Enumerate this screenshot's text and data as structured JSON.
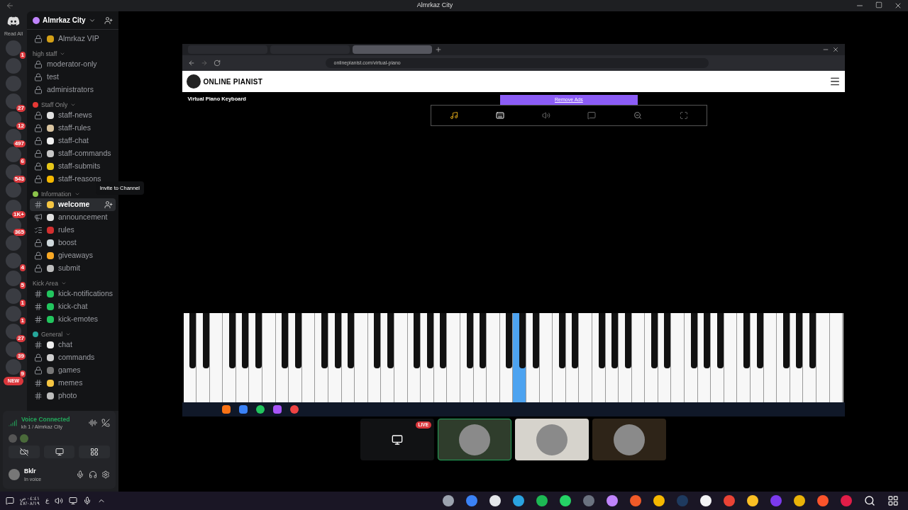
{
  "window": {
    "title": "Almrkaz City"
  },
  "servers": {
    "read_all": "Read All",
    "new_label": "NEW",
    "items": [
      {
        "kind": "badge",
        "badge": "1"
      },
      {
        "kind": "plain"
      },
      {
        "kind": "plain"
      },
      {
        "kind": "badge",
        "badge": "27"
      },
      {
        "kind": "badge",
        "badge": "12"
      },
      {
        "kind": "badge",
        "badge": "497"
      },
      {
        "kind": "badge",
        "badge": "6"
      },
      {
        "kind": "badge",
        "badge": "543"
      },
      {
        "kind": "plain"
      },
      {
        "kind": "badge",
        "badge": "1K+"
      },
      {
        "kind": "badge",
        "badge": "365"
      },
      {
        "kind": "plain"
      },
      {
        "kind": "badge",
        "badge": "4"
      },
      {
        "kind": "badge",
        "badge": "5"
      },
      {
        "kind": "badge",
        "badge": "1"
      },
      {
        "kind": "badge",
        "badge": "1"
      },
      {
        "kind": "badge",
        "badge": "27"
      },
      {
        "kind": "badge",
        "badge": "39"
      },
      {
        "kind": "badge",
        "badge": "9"
      }
    ]
  },
  "server_header": {
    "name": "Almrkaz City"
  },
  "pinned_channel": {
    "name": "Almrkaz VIP",
    "kind": "locked",
    "color": "#d4a017"
  },
  "categories": [
    {
      "name": "high staff",
      "channels": [
        {
          "name": "moderator-only",
          "kind": "locked",
          "selected": false
        },
        {
          "name": "test",
          "kind": "locked",
          "selected": false
        },
        {
          "name": "administrators",
          "kind": "locked",
          "selected": false
        }
      ]
    },
    {
      "name": "Staff Only",
      "color": "#e53935",
      "channels": [
        {
          "name": "staff-news",
          "kind": "locked",
          "color": "#e0e0e0",
          "selected": false
        },
        {
          "name": "staff-rules",
          "kind": "locked",
          "color": "#d9c4a0",
          "selected": false
        },
        {
          "name": "staff-chat",
          "kind": "locked",
          "color": "#f0f0f0",
          "selected": false
        },
        {
          "name": "staff-commands",
          "kind": "locked",
          "color": "#c8c8c8",
          "selected": false
        },
        {
          "name": "staff-submits",
          "kind": "locked",
          "color": "#e6c619",
          "selected": false
        },
        {
          "name": "staff-reasons",
          "kind": "locked",
          "color": "#f5b800",
          "selected": false
        }
      ]
    },
    {
      "name": "Information",
      "color": "#8bc34a",
      "channels": [
        {
          "name": "welcome",
          "kind": "text",
          "color": "#f5c542",
          "selected": true
        },
        {
          "name": "announcement",
          "kind": "announce",
          "color": "#e0e0e0",
          "selected": false
        },
        {
          "name": "rules",
          "kind": "rules",
          "color": "#d32f2f",
          "selected": false
        },
        {
          "name": "boost",
          "kind": "locked",
          "color": "#cfd8dc",
          "selected": false
        },
        {
          "name": "giveaways",
          "kind": "locked",
          "color": "#f9a825",
          "selected": false
        },
        {
          "name": "submit",
          "kind": "locked",
          "color": "#bdbdbd",
          "selected": false
        }
      ]
    },
    {
      "name": "Kick Area",
      "channels": [
        {
          "name": "kick-notifications",
          "kind": "text",
          "color": "#22c55e",
          "selected": false
        },
        {
          "name": "kick-chat",
          "kind": "text",
          "color": "#22c55e",
          "selected": false
        },
        {
          "name": "kick-emotes",
          "kind": "text",
          "color": "#22c55e",
          "selected": false
        }
      ]
    },
    {
      "name": "General",
      "color": "#26a69a",
      "channels": [
        {
          "name": "chat",
          "kind": "text",
          "color": "#eeeeee",
          "selected": false
        },
        {
          "name": "commands",
          "kind": "locked",
          "color": "#cfcfcf",
          "selected": false
        },
        {
          "name": "games",
          "kind": "locked",
          "color": "#777777",
          "selected": false
        },
        {
          "name": "memes",
          "kind": "text",
          "color": "#f5c542",
          "selected": false
        },
        {
          "name": "photo",
          "kind": "text",
          "color": "#bdbdbd",
          "selected": false
        }
      ]
    }
  ],
  "tooltip": "Invite to Channel",
  "voice": {
    "status": "Voice Connected",
    "channel": "kh 1 / Almrkaz City"
  },
  "user": {
    "name": "Bklr",
    "status": "In voice"
  },
  "browser": {
    "tabs": [
      {
        "selected": false
      },
      {
        "selected": false
      },
      {
        "selected": true
      }
    ],
    "url": "onlinepianist.com/virtual-piano",
    "site_name": "ONLINE PIANIST",
    "heading": "Virtual Piano Keyboard",
    "ad_link": "Remove Ads",
    "keys": [
      {
        "selected": false
      },
      {
        "selected": false
      },
      {
        "selected": false
      },
      {
        "selected": false
      },
      {
        "selected": false
      },
      {
        "selected": false
      },
      {
        "selected": false
      },
      {
        "selected": false
      },
      {
        "selected": false
      },
      {
        "selected": false
      },
      {
        "selected": false
      },
      {
        "selected": false
      },
      {
        "selected": false
      },
      {
        "selected": false
      },
      {
        "selected": false
      },
      {
        "selected": false
      },
      {
        "selected": false
      },
      {
        "selected": false
      },
      {
        "selected": false
      },
      {
        "selected": false
      },
      {
        "selected": false
      },
      {
        "selected": false
      },
      {
        "selected": false
      },
      {
        "selected": false
      },
      {
        "selected": false
      },
      {
        "selected": true
      },
      {
        "selected": false
      },
      {
        "selected": false
      },
      {
        "selected": false
      },
      {
        "selected": false
      },
      {
        "selected": false
      },
      {
        "selected": false
      },
      {
        "selected": false
      },
      {
        "selected": false
      },
      {
        "selected": false
      },
      {
        "selected": false
      },
      {
        "selected": false
      },
      {
        "selected": false
      },
      {
        "selected": false
      },
      {
        "selected": false
      },
      {
        "selected": false
      },
      {
        "selected": false
      },
      {
        "selected": false
      },
      {
        "selected": false
      },
      {
        "selected": false
      },
      {
        "selected": false
      },
      {
        "selected": false
      },
      {
        "selected": false
      },
      {
        "selected": false
      },
      {
        "selected": false
      }
    ]
  },
  "stream_tiles": [
    {
      "kind": "screen",
      "badge": "LIVE"
    },
    {
      "kind": "avatar",
      "color": "#2f3d2c",
      "selected": true
    },
    {
      "kind": "avatar",
      "color": "#d6d3cc",
      "selected": false
    },
    {
      "kind": "avatar",
      "color": "#2e2418",
      "selected": false
    }
  ],
  "taskbar": {
    "time": "٠٤:٤١ ص",
    "date": "٤٧/٠٨/١٩",
    "language": "ع",
    "apps": [
      {
        "color": "#9ca3af"
      },
      {
        "color": "#3b82f6"
      },
      {
        "color": "#e5e7eb"
      },
      {
        "color": "#2aa3e0"
      },
      {
        "color": "#1db954"
      },
      {
        "color": "#25d366"
      },
      {
        "color": "#6b7280"
      },
      {
        "color": "#c084fc"
      },
      {
        "color": "#f05a28"
      },
      {
        "color": "#f6b800"
      },
      {
        "color": "#1e3a5f"
      },
      {
        "color": "#f3f4f6"
      },
      {
        "color": "#ea4335"
      },
      {
        "color": "#fbbf24"
      },
      {
        "color": "#7c3aed"
      },
      {
        "color": "#eab308"
      },
      {
        "color": "#fb542b"
      },
      {
        "color": "#e11d48"
      }
    ]
  }
}
